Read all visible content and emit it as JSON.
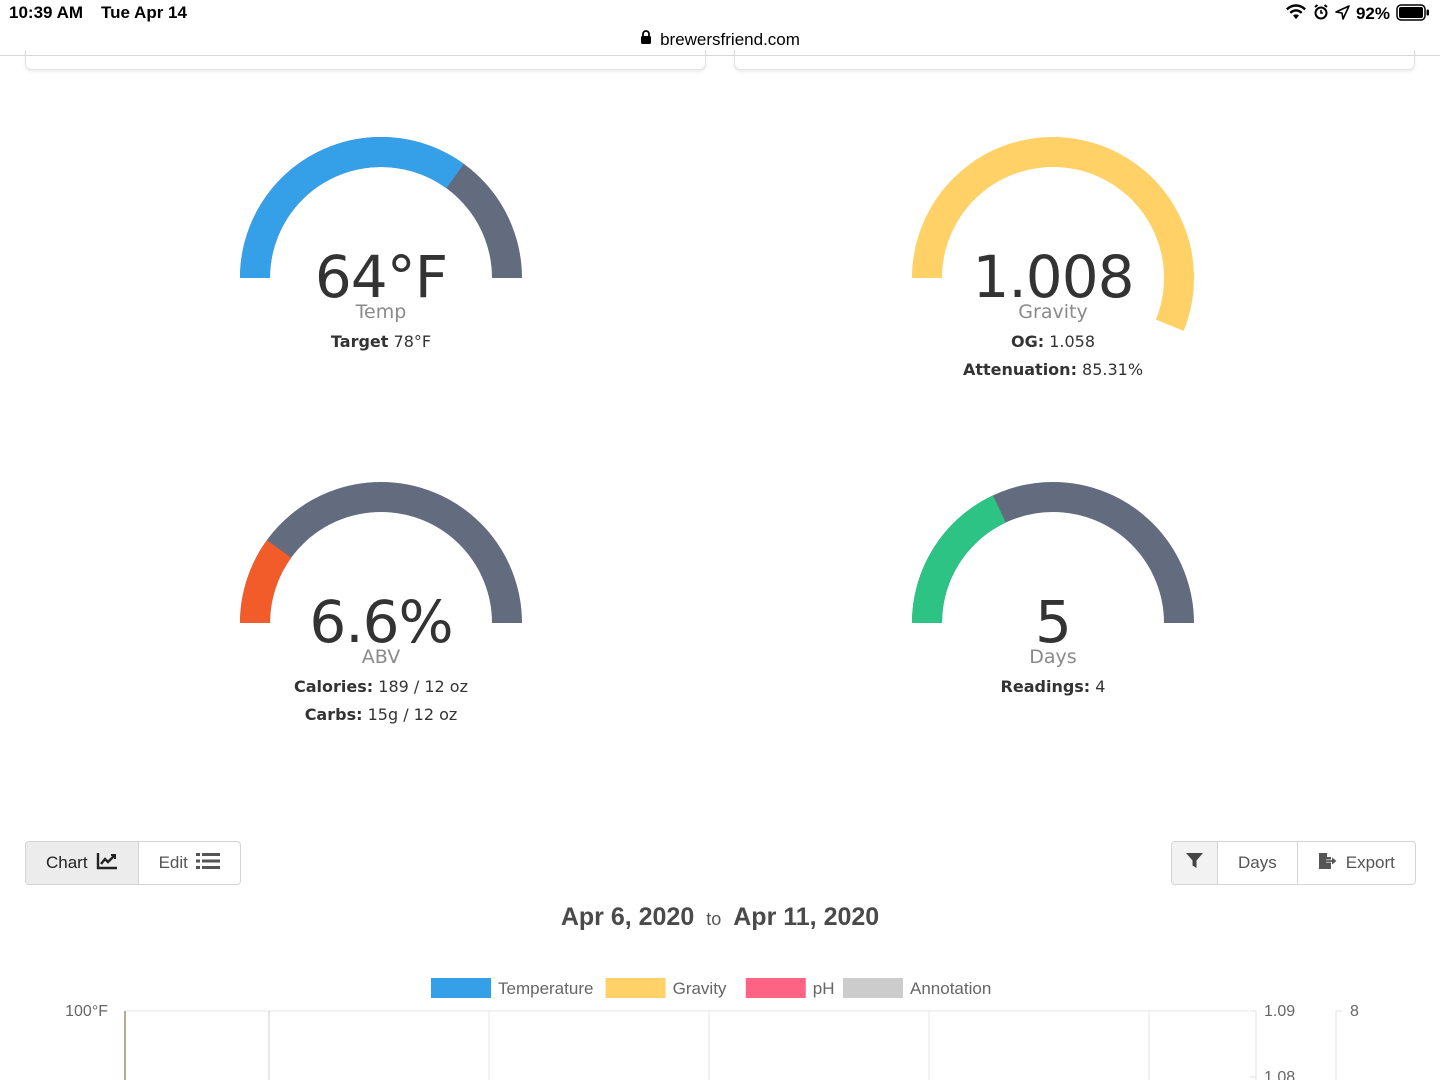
{
  "status_bar": {
    "time": "10:39 AM",
    "date": "Tue Apr 14",
    "battery": "92%"
  },
  "url_bar": {
    "url": "brewersfriend.com"
  },
  "gauges": {
    "temp": {
      "value": "64°F",
      "label": "Temp",
      "fill_fraction": 0.7,
      "color": "#35a0e8",
      "details": [
        {
          "key": "Target",
          "val": " 78°F"
        }
      ]
    },
    "gravity": {
      "value": "1.008",
      "label": "Gravity",
      "fill_fraction": 1.0,
      "color": "#ffd166",
      "details": [
        {
          "key": "OG:",
          "val": " 1.058"
        },
        {
          "key": "Attenuation:",
          "val": " 85.31%"
        }
      ]
    },
    "abv": {
      "value": "6.6%",
      "label": "ABV",
      "fill_fraction": 0.2,
      "color": "#f25c2a",
      "details": [
        {
          "key": "Calories:",
          "val": " 189 / 12 oz"
        },
        {
          "key": "Carbs:",
          "val": " 15g / 12 oz"
        }
      ]
    },
    "days": {
      "value": "5",
      "label": "Days",
      "fill_fraction": 0.36,
      "color": "#2cc385",
      "details": [
        {
          "key": "Readings:",
          "val": " 4"
        }
      ]
    }
  },
  "gauge_track_color": "#636b7f",
  "toolbar": {
    "chart_label": "Chart",
    "edit_label": "Edit",
    "days_label": "Days",
    "export_label": "Export"
  },
  "date_range": {
    "start": "Apr 6, 2020",
    "to": "to",
    "end": "Apr 11, 2020"
  },
  "chart_data": {
    "type": "line",
    "legend": [
      {
        "name": "Temperature",
        "color": "#35a0e8"
      },
      {
        "name": "Gravity",
        "color": "#ffd166"
      },
      {
        "name": "pH",
        "color": "#ff6384"
      },
      {
        "name": "Annotation",
        "color": "#cccccc"
      }
    ],
    "y_left_ticks": [
      "100°F"
    ],
    "y_right_ticks": [
      "1.09",
      "1.08"
    ],
    "y_right2_ticks": [
      "8"
    ],
    "grid": true
  }
}
